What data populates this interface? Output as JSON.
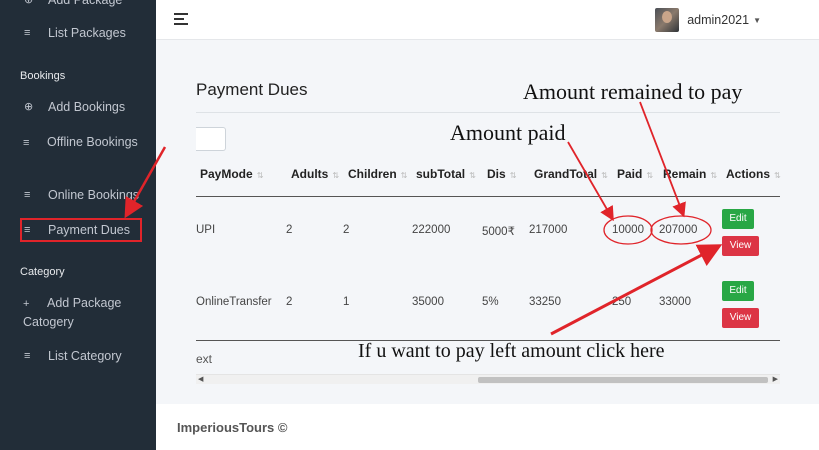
{
  "sidebar": {
    "top_item": "Add Package",
    "list_packages": "List Packages",
    "bookings_header": "Bookings",
    "add_bookings": "Add Bookings",
    "offline_bookings": "Offline Bookings",
    "online_bookings": "Online Bookings",
    "payment_dues": "Payment Dues",
    "category_header": "Category",
    "add_package_category": "Add Package Catogery",
    "list_category": "List Category"
  },
  "header": {
    "username": "admin2021",
    "menu_icon": "hamburger-icon",
    "dropdown_icon": "caret-down-icon"
  },
  "main": {
    "title": "Payment Dues",
    "columns": [
      "PayMode",
      "Adults",
      "Children",
      "subTotal",
      "Dis",
      "GrandTotal",
      "Paid",
      "Remain",
      "Actions"
    ],
    "rows": [
      {
        "paymode": "UPI",
        "adults": "2",
        "children": "2",
        "subtotal": "222000",
        "dis": "5000₹",
        "grandtotal": "217000",
        "paid": "10000",
        "remain": "207000"
      },
      {
        "paymode": "OnlineTransfer",
        "adults": "2",
        "children": "1",
        "subtotal": "35000",
        "dis": "5%",
        "grandtotal": "33250",
        "paid": "250",
        "remain": "33000"
      }
    ],
    "edit_label": "Edit",
    "view_label": "View",
    "info_text": "ext"
  },
  "annotations": {
    "remain_note": "Amount remained to pay",
    "paid_note": "Amount paid",
    "click_note": "If u want to pay left amount click here"
  },
  "footer": {
    "text": "ImperiousTours ©"
  },
  "colors": {
    "sidebar_bg": "#222d38",
    "edit_button": "#28a745",
    "view_button": "#dc3545",
    "annotation": "#e0242a"
  }
}
